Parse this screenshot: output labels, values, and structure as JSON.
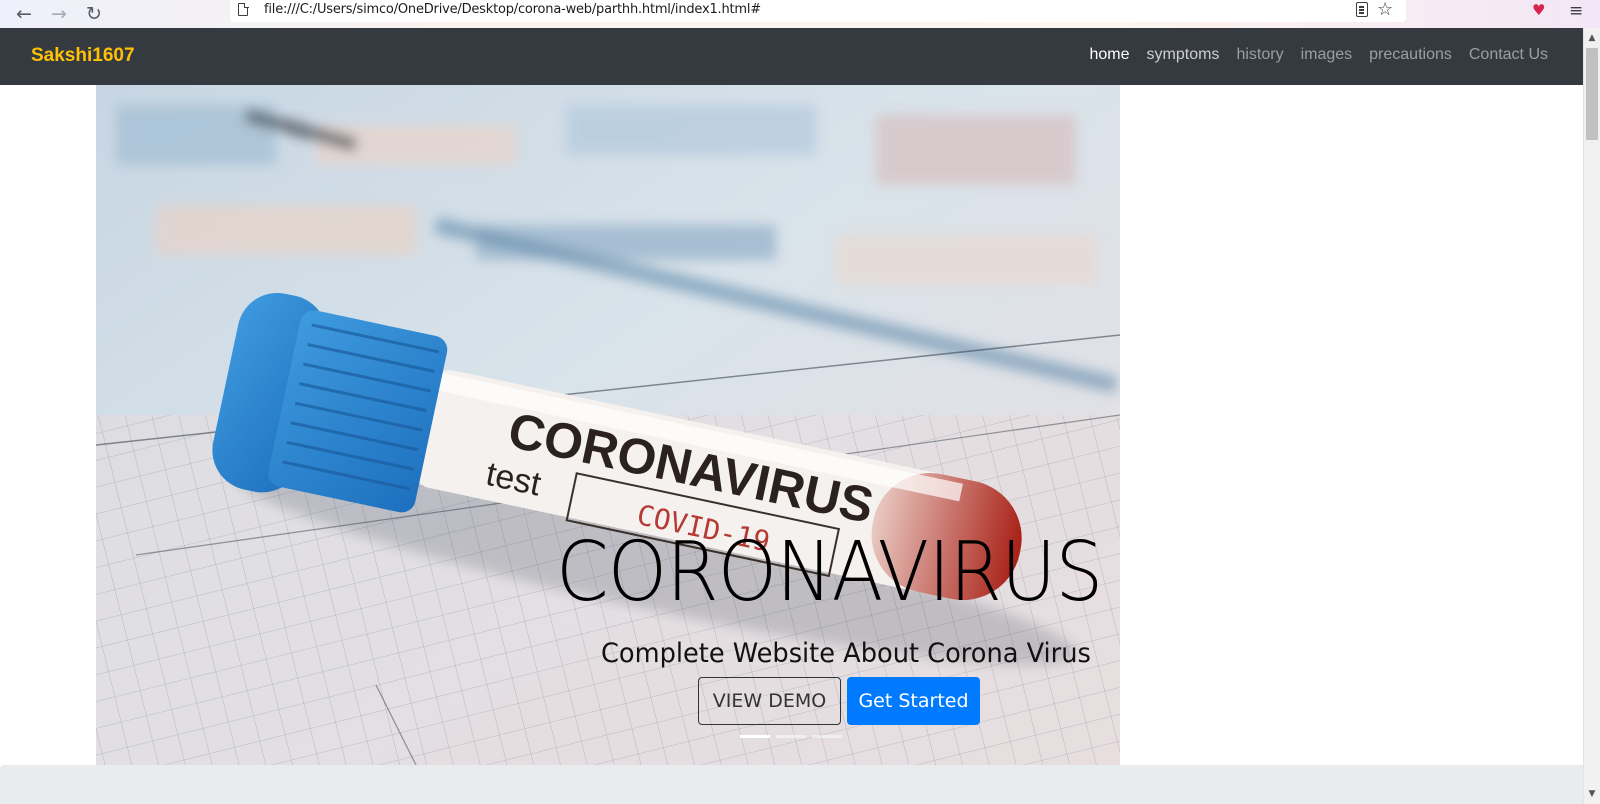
{
  "browser": {
    "url": "file:///C:/Users/simco/OneDrive/Desktop/corona-web/parthh.html/index1.html#",
    "back_glyph": "←",
    "forward_glyph": "→",
    "reload_glyph": "↻",
    "star_glyph": "☆",
    "pocket_glyph": "♥",
    "menu_glyph": "≡"
  },
  "navbar": {
    "brand": "Sakshi1607",
    "brand_color": "#ffc107",
    "background": "#343a40",
    "links": [
      {
        "label": "home",
        "state": "active"
      },
      {
        "label": "symptoms",
        "state": "hover"
      },
      {
        "label": "history",
        "state": "normal"
      },
      {
        "label": "images",
        "state": "normal"
      },
      {
        "label": "precautions",
        "state": "normal"
      },
      {
        "label": "Contact Us",
        "state": "normal"
      }
    ]
  },
  "hero": {
    "image_text": {
      "tube_label": "CORONAVIRUS",
      "tube_sub": "test",
      "tube_stamp": "COVID-19"
    },
    "heading": "CORONAVIRUS",
    "subheading": "Complete Website About Corona Virus",
    "buttons": {
      "demo": "VIEW DEMO",
      "start": "Get Started",
      "start_color": "#007bff"
    },
    "indicators": {
      "count": 3,
      "active_index": 0
    }
  },
  "icons": {
    "back": "arrow-left-icon",
    "forward": "arrow-right-icon",
    "reload": "reload-icon",
    "page": "page-icon",
    "reader": "reader-view-icon",
    "bookmark": "star-icon",
    "pocket": "pocket-icon",
    "menu": "hamburger-menu-icon"
  }
}
